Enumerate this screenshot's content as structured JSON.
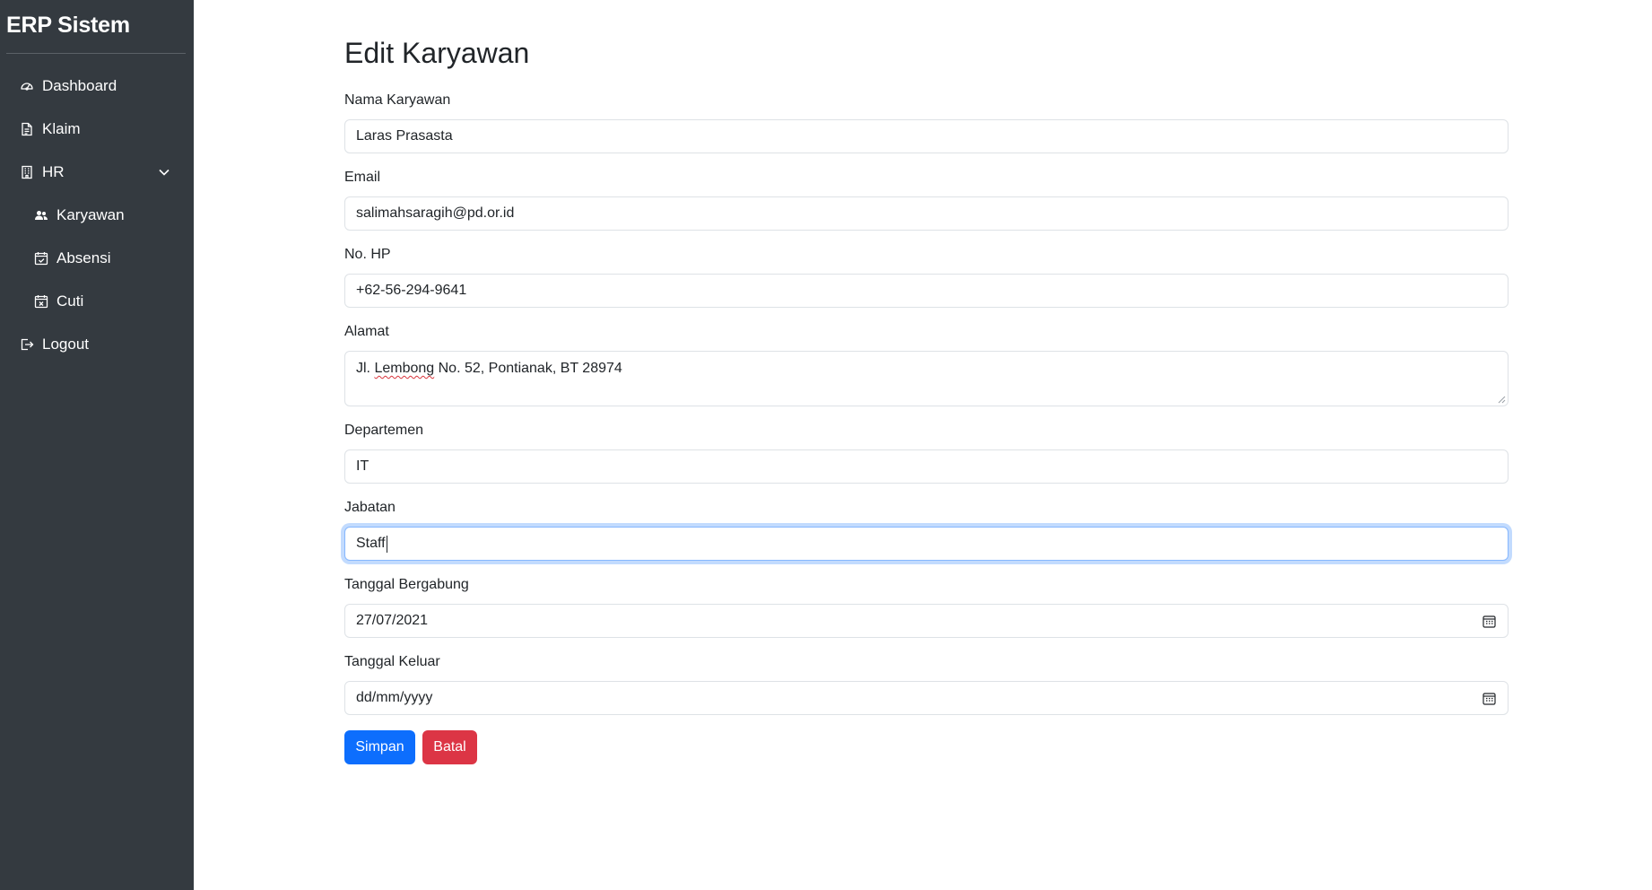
{
  "sidebar": {
    "brand": "ERP Sistem",
    "items": [
      {
        "label": "Dashboard",
        "icon": "speedometer-icon"
      },
      {
        "label": "Klaim",
        "icon": "document-icon"
      },
      {
        "label": "HR",
        "icon": "building-icon",
        "expanded": true
      },
      {
        "label": "Karyawan",
        "icon": "people-icon"
      },
      {
        "label": "Absensi",
        "icon": "calendar-check-icon"
      },
      {
        "label": "Cuti",
        "icon": "calendar-x-icon"
      },
      {
        "label": "Logout",
        "icon": "logout-icon"
      }
    ]
  },
  "form": {
    "title": "Edit Karyawan",
    "fields": [
      {
        "label": "Nama Karyawan",
        "value": "Laras Prasasta"
      },
      {
        "label": "Email",
        "value": "salimahsaragih@pd.or.id"
      },
      {
        "label": "No. HP",
        "value": "+62-56-294-9641"
      },
      {
        "label": "Alamat",
        "value_before": "Jl. ",
        "value_misspelled": "Lembong",
        "value_after": " No. 52, Pontianak, BT 28974"
      },
      {
        "label": "Departemen",
        "value": "IT"
      },
      {
        "label": "Jabatan",
        "value": "Staff"
      },
      {
        "label": "Tanggal Bergabung",
        "value": "27/07/2021"
      },
      {
        "label": "Tanggal Keluar",
        "value": "dd/mm/yyyy"
      }
    ],
    "buttons": {
      "save": "Simpan",
      "cancel": "Batal"
    }
  },
  "colors": {
    "sidebar_bg": "#343a40",
    "primary": "#0d6efd",
    "danger": "#dc3545",
    "focus_border": "#86b7fe"
  }
}
